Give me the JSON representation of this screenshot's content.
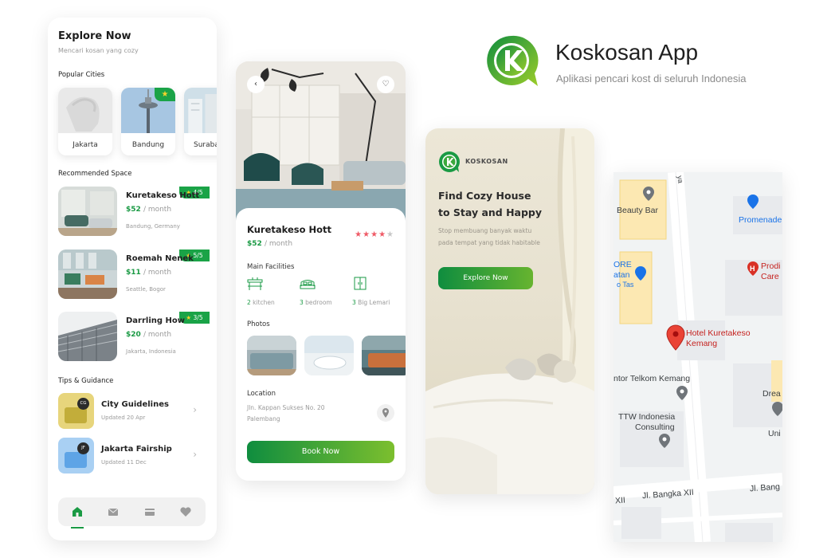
{
  "branding": {
    "app_title": "Koskosan App",
    "tagline": "Aplikasi pencari kost di seluruh Indonesia",
    "colors": {
      "primary": "#1a9a44",
      "accent": "#7cbf2e",
      "star": "#f6d32b",
      "rating": "#ef5a66"
    }
  },
  "explore": {
    "title": "Explore Now",
    "subtitle": "Mencari kosan yang cozy",
    "popular_heading": "Popular Cities",
    "cities": [
      {
        "label": "Jakarta"
      },
      {
        "label": "Bandung",
        "featured": true
      },
      {
        "label": "Surabaya"
      }
    ],
    "recommended_heading": "Recommended Space",
    "spaces": [
      {
        "name": "Kuretakeso Hott",
        "price": "$52",
        "unit": "/ month",
        "location": "Bandung, Germany",
        "rating": "4/5"
      },
      {
        "name": "Roemah Nenek",
        "price": "$11",
        "unit": "/ month",
        "location": "Seattle, Bogor",
        "rating": "5/5"
      },
      {
        "name": "Darrling How",
        "price": "$20",
        "unit": "/ month",
        "location": "Jakarta, Indonesia",
        "rating": "3/5"
      }
    ],
    "tips_heading": "Tips & Guidance",
    "tips": [
      {
        "initials": "CG",
        "title": "City Guidelines",
        "updated": "Updated 20 Apr"
      },
      {
        "initials": "JF",
        "title": "Jakarta Fairship",
        "updated": "Updated 11 Dec"
      }
    ],
    "nav": [
      "home-icon",
      "mail-icon",
      "card-icon",
      "heart-icon"
    ]
  },
  "detail": {
    "name": "Kuretakeso Hott",
    "price": "$52",
    "unit": "/ month",
    "rating_stars": 4,
    "facilities_heading": "Main Facilities",
    "facilities": [
      {
        "count": "2",
        "label": "kitchen"
      },
      {
        "count": "3",
        "label": "bedroom"
      },
      {
        "count": "3",
        "label": "Big Lemari"
      }
    ],
    "photos_heading": "Photos",
    "location_heading": "Location",
    "address_line1": "Jln. Kappan Sukses No. 20",
    "address_line2": "Palembang",
    "book_label": "Book Now"
  },
  "splash": {
    "brand": "KOSKOSAN",
    "headline_1": "Find Cozy House",
    "headline_2": "to Stay and Happy",
    "desc_1": "Stop membuang banyak waktu",
    "desc_2": "pada tempat yang tidak habitable",
    "button": "Explore Now"
  },
  "map": {
    "labels": {
      "ya": "ya",
      "beauty_bar": "Beauty Bar",
      "promenade": "Promenade",
      "ore": "ORE",
      "atan": "atan",
      "o_tas": "o Tas",
      "prodi": "Prodi",
      "care": "Care",
      "hotel_1": "Hotel Kuretakeso",
      "hotel_2": "Kemang",
      "telkom": "ntor Telkom Kemang",
      "dream": "Drea",
      "ttw_1": "TTW Indonesia",
      "ttw_2": "Consulting",
      "uni": "Uni",
      "xii_left": "XII",
      "bangka": "Jl. Bangka XII",
      "bangka_right": "Jl. Bang"
    }
  }
}
